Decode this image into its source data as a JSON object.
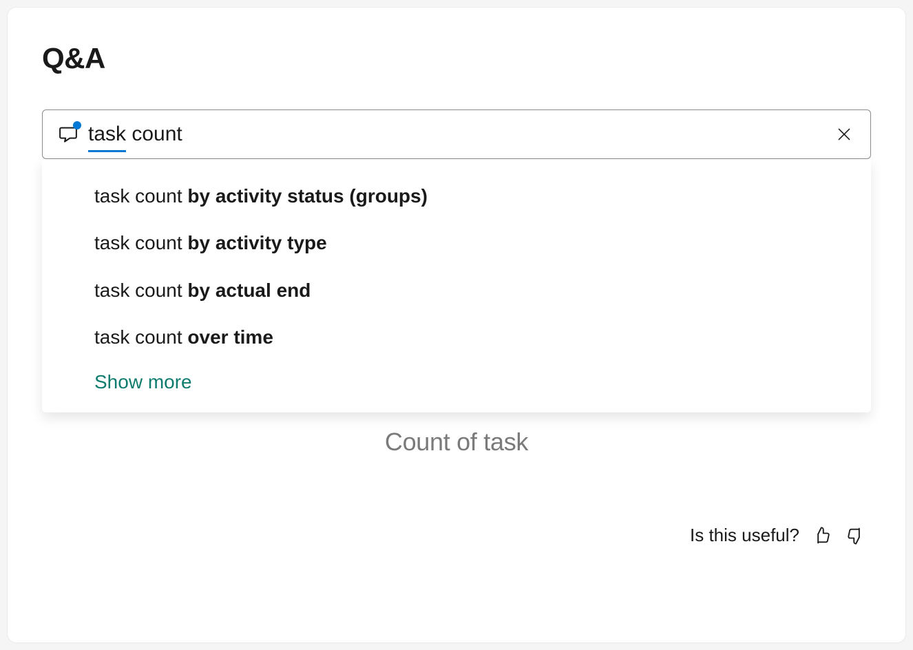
{
  "title": "Q&A",
  "query": {
    "value": "task count",
    "underline_token": "task"
  },
  "suggestions": [
    {
      "prefix": "task count ",
      "bold": "by activity status (groups)"
    },
    {
      "prefix": "task count ",
      "bold": "by activity type"
    },
    {
      "prefix": "task count ",
      "bold": "by actual end"
    },
    {
      "prefix": "task count ",
      "bold": "over time"
    }
  ],
  "show_more_label": "Show more",
  "result_title": "Count of task",
  "feedback": {
    "prompt": "Is this useful?"
  }
}
